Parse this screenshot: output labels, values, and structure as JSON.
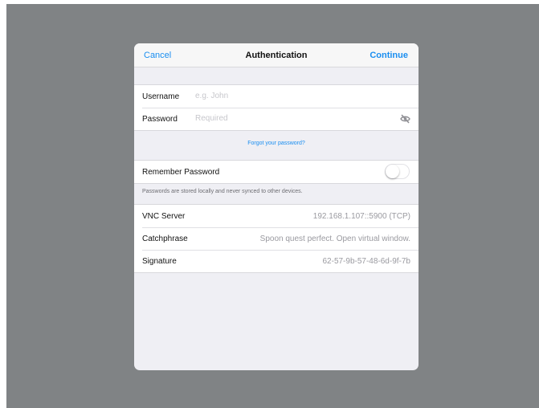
{
  "navbar": {
    "cancel_label": "Cancel",
    "title": "Authentication",
    "continue_label": "Continue"
  },
  "credentials": {
    "username_label": "Username",
    "username_placeholder": "e.g. John",
    "password_label": "Password",
    "password_placeholder": "Required",
    "password_toggle_icon": "eye-slash-icon"
  },
  "forgot_password_label": "Forgot your password?",
  "remember": {
    "label": "Remember Password",
    "enabled": false,
    "footnote": "Passwords are stored locally and never synced to other devices."
  },
  "server_info": {
    "rows": [
      {
        "label": "VNC Server",
        "value": "192.168.1.107::5900 (TCP)"
      },
      {
        "label": "Catchphrase",
        "value": "Spoon quest perfect. Open virtual window."
      },
      {
        "label": "Signature",
        "value": "62-57-9b-57-48-6d-9f-7b"
      }
    ]
  },
  "colors": {
    "accent": "#1a8ef0",
    "backdrop": "#808385",
    "grouped_background": "#efeff4"
  }
}
